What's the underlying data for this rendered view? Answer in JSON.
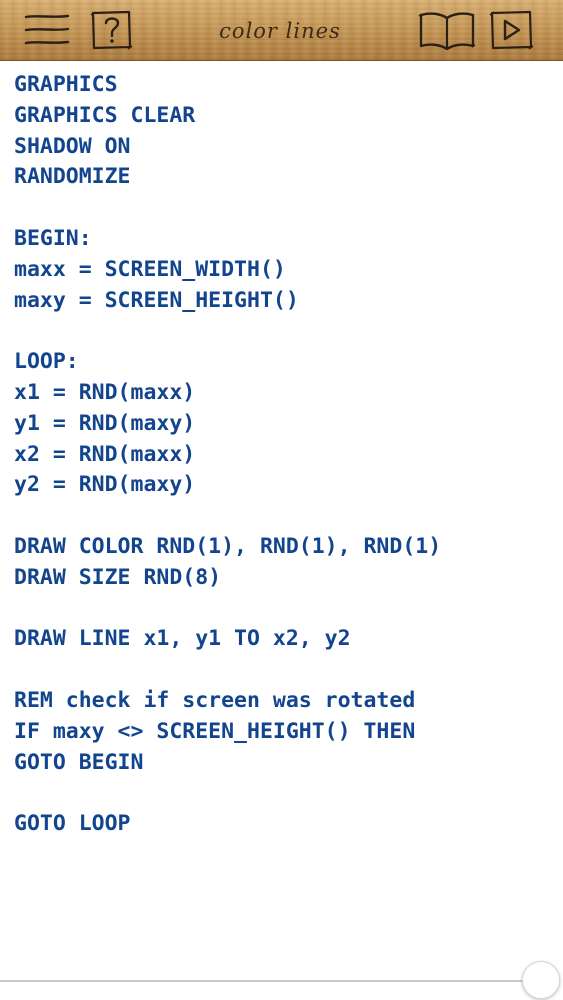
{
  "toolbar": {
    "title": "color lines",
    "buttons": [
      {
        "id": "menu",
        "icon": "menu-icon"
      },
      {
        "id": "help",
        "icon": "help-icon",
        "glyph": "?"
      },
      {
        "id": "book",
        "icon": "book-icon"
      },
      {
        "id": "run",
        "icon": "play-icon"
      }
    ]
  },
  "editor": {
    "code_color": "#13458f",
    "lines": [
      "GRAPHICS",
      "GRAPHICS CLEAR",
      "SHADOW ON",
      "RANDOMIZE",
      "",
      "BEGIN:",
      "maxx = SCREEN_WIDTH()",
      "maxy = SCREEN_HEIGHT()",
      "",
      "LOOP:",
      "x1 = RND(maxx)",
      "y1 = RND(maxy)",
      "x2 = RND(maxx)",
      "y2 = RND(maxy)",
      "",
      "DRAW COLOR RND(1), RND(1), RND(1)",
      "DRAW SIZE RND(8)",
      "",
      "DRAW LINE x1, y1 TO x2, y2",
      "",
      "REM check if screen was rotated",
      "IF maxy <> SCREEN_HEIGHT() THEN",
      "GOTO BEGIN",
      "",
      "GOTO LOOP"
    ]
  },
  "scrollbar": {
    "horizontal_position": 1.0
  }
}
